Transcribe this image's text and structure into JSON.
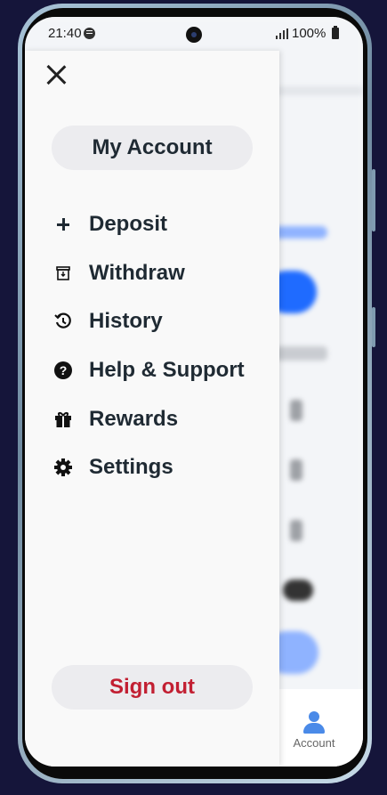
{
  "status_bar": {
    "time": "21:40",
    "battery": "100%"
  },
  "drawer": {
    "account_label": "My Account",
    "menu": [
      {
        "label": "Deposit",
        "icon": "plus-icon"
      },
      {
        "label": "Withdraw",
        "icon": "withdraw-box-icon"
      },
      {
        "label": "History",
        "icon": "history-icon"
      },
      {
        "label": "Help & Support",
        "icon": "help-icon"
      },
      {
        "label": "Rewards",
        "icon": "gift-icon"
      },
      {
        "label": "Settings",
        "icon": "gear-icon"
      }
    ],
    "sign_out_label": "Sign out"
  },
  "bottom_nav": {
    "account_label": "Account"
  },
  "colors": {
    "accent_blue": "#1f6bff",
    "sign_out_red": "#c21f32",
    "text_dark": "#1f2a33"
  }
}
